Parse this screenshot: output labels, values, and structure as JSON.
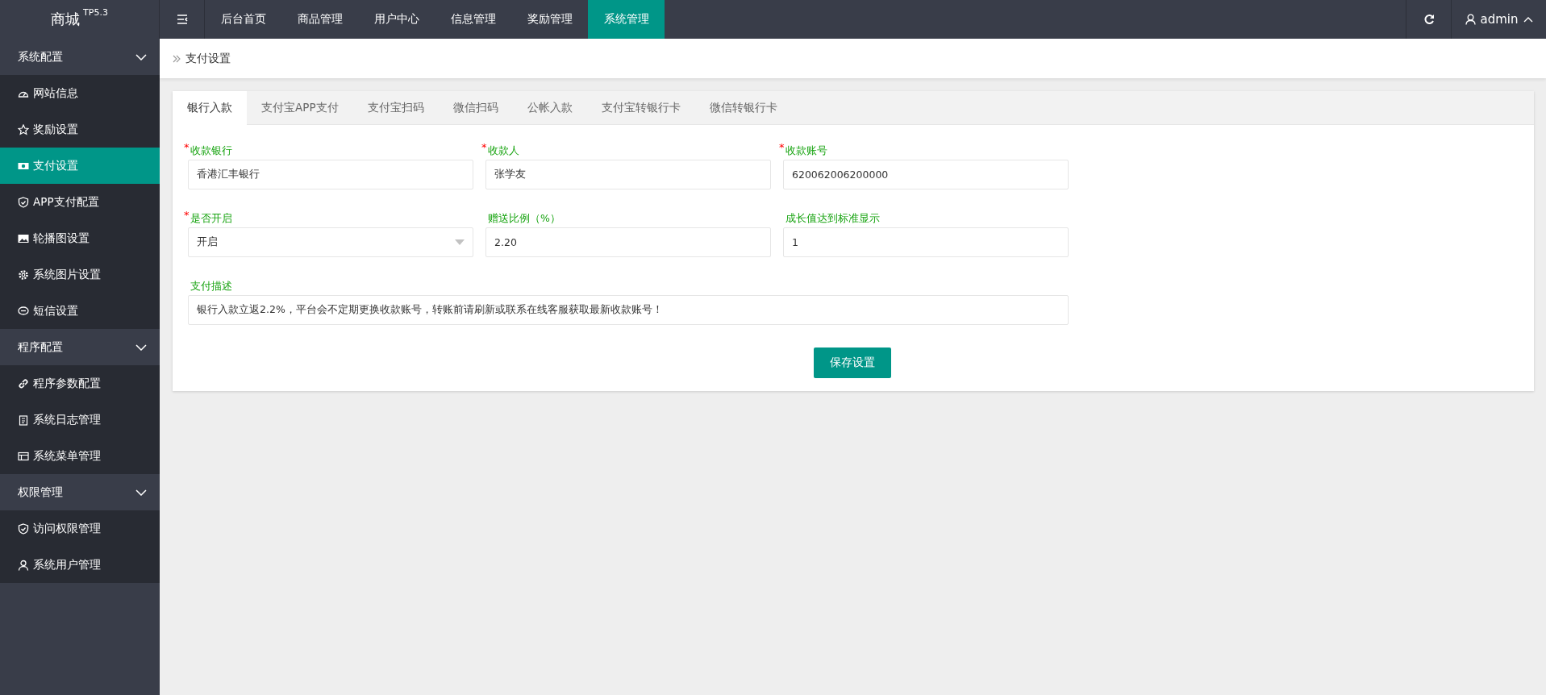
{
  "brand": {
    "name": "商城",
    "version": "TP5.3"
  },
  "top_nav": [
    {
      "label": "后台首页",
      "selected": false
    },
    {
      "label": "商品管理",
      "selected": false
    },
    {
      "label": "用户中心",
      "selected": false
    },
    {
      "label": "信息管理",
      "selected": false
    },
    {
      "label": "奖励管理",
      "selected": false
    },
    {
      "label": "系统管理",
      "selected": true
    }
  ],
  "user": {
    "name": "admin",
    "expanded": true
  },
  "sidebar": [
    {
      "title": "系统配置",
      "expanded": true,
      "items": [
        {
          "label": "网站信息",
          "selected": false
        },
        {
          "label": "奖励设置",
          "selected": false
        },
        {
          "label": "支付设置",
          "selected": true
        },
        {
          "label": "APP支付配置",
          "selected": false
        },
        {
          "label": "轮播图设置",
          "selected": false
        },
        {
          "label": "系统图片设置",
          "selected": false
        },
        {
          "label": "短信设置",
          "selected": false
        }
      ]
    },
    {
      "title": "程序配置",
      "expanded": true,
      "items": [
        {
          "label": "程序参数配置",
          "selected": false
        },
        {
          "label": "系统日志管理",
          "selected": false
        },
        {
          "label": "系统菜单管理",
          "selected": false
        }
      ]
    },
    {
      "title": "权限管理",
      "expanded": true,
      "items": [
        {
          "label": "访问权限管理",
          "selected": false
        },
        {
          "label": "系统用户管理",
          "selected": false
        }
      ]
    }
  ],
  "breadcrumb": "支付设置",
  "tabs": [
    {
      "label": "银行入款",
      "selected": true
    },
    {
      "label": "支付宝APP支付",
      "selected": false
    },
    {
      "label": "支付宝扫码",
      "selected": false
    },
    {
      "label": "微信扫码",
      "selected": false
    },
    {
      "label": "公帐入款",
      "selected": false
    },
    {
      "label": "支付宝转银行卡",
      "selected": false
    },
    {
      "label": "微信转银行卡",
      "selected": false
    }
  ],
  "form_rows": [
    [
      {
        "kind": "text",
        "label": "收款银行",
        "required": true,
        "value": "香港汇丰银行"
      },
      {
        "kind": "text",
        "label": "收款人",
        "required": true,
        "value": "张学友"
      },
      {
        "kind": "text",
        "label": "收款账号",
        "required": true,
        "value": "620062006200000"
      }
    ],
    [
      {
        "kind": "select",
        "label": "是否开启",
        "required": true,
        "value": "开启"
      },
      {
        "kind": "text",
        "label": "赠送比例（%）",
        "required": false,
        "value": "2.20"
      },
      {
        "kind": "text",
        "label": "成长值达到标准显示",
        "required": false,
        "value": "1"
      }
    ],
    [
      {
        "kind": "wide",
        "label": "支付描述",
        "required": false,
        "value": "银行入款立返2.2%，平台会不定期更换收款账号，转账前请刷新或联系在线客服获取最新收款账号！"
      }
    ]
  ],
  "required_mark": "*",
  "save_button": "保存设置"
}
